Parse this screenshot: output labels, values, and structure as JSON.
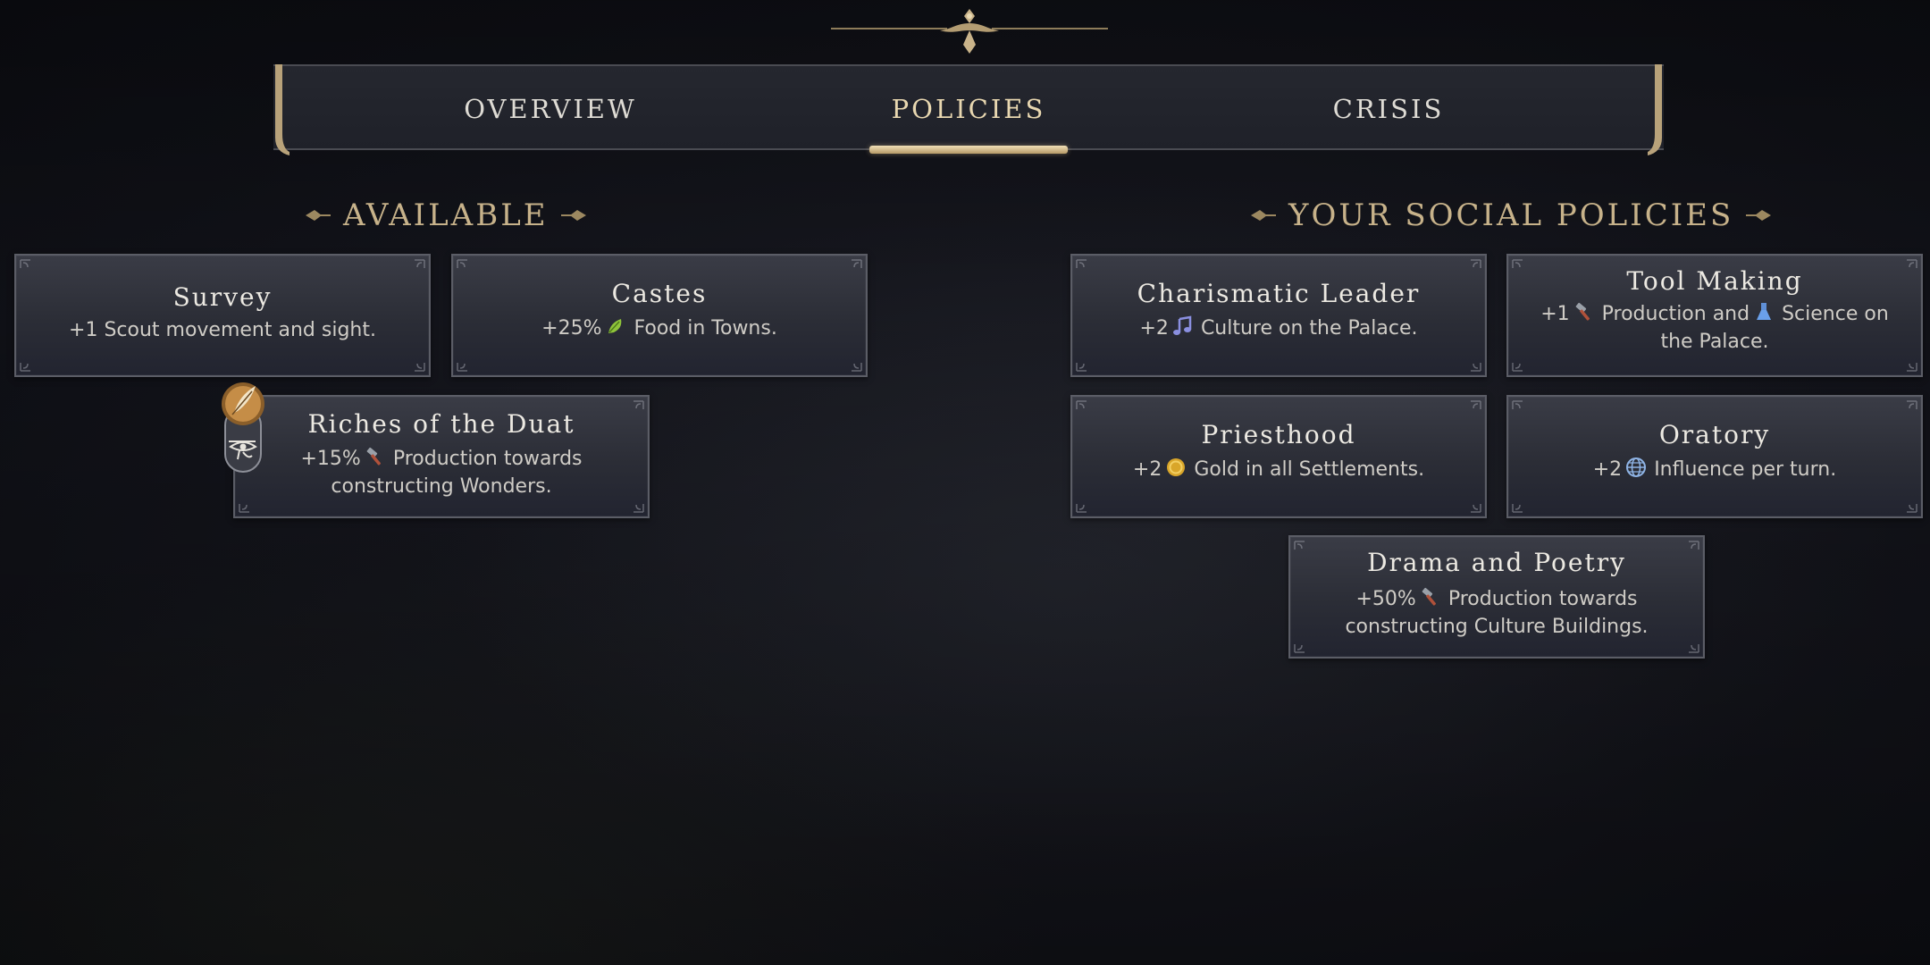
{
  "tabs": [
    {
      "label": "OVERVIEW",
      "active": false
    },
    {
      "label": "POLICIES",
      "active": true
    },
    {
      "label": "CRISIS",
      "active": false
    }
  ],
  "available": {
    "title": "AVAILABLE",
    "cards": [
      {
        "title": "Survey",
        "desc_1": "+1 Scout movement and sight."
      },
      {
        "title": "Castes",
        "desc_pre": "+25%",
        "icon": "food-icon",
        "desc_post": "Food in Towns."
      },
      {
        "title": "Riches of the Duat",
        "desc_pre": "+15%",
        "icon": "production-icon",
        "desc_post": "Production towards",
        "desc_2": "constructing Wonders.",
        "badge_icon": "eye-of-horus-icon"
      }
    ]
  },
  "your_policies": {
    "title": "YOUR SOCIAL POLICIES",
    "cards": [
      {
        "title": "Charismatic Leader",
        "desc_pre": "+2",
        "icon": "culture-icon",
        "desc_post": "Culture on the Palace."
      },
      {
        "title": "Tool Making",
        "desc_pre": "+1",
        "icon": "production-icon",
        "desc_mid": "Production and",
        "icon2": "science-icon",
        "desc_post": "Science on",
        "desc_2": "the Palace."
      },
      {
        "title": "Priesthood",
        "desc_pre": "+2",
        "icon": "gold-icon",
        "desc_post": "Gold in all Settlements."
      },
      {
        "title": "Oratory",
        "desc_pre": "+2",
        "icon": "influence-icon",
        "desc_post": "Influence per turn."
      },
      {
        "title": "Drama and Poetry",
        "desc_pre": "+50%",
        "icon": "production-icon",
        "desc_post": "Production towards",
        "desc_2": "constructing Culture Buildings."
      }
    ]
  },
  "colors": {
    "accent_gold": "#c7b28a",
    "tab_underline": "#e8d7b0",
    "card_border": "#5b5d66",
    "background": "#14151c"
  }
}
